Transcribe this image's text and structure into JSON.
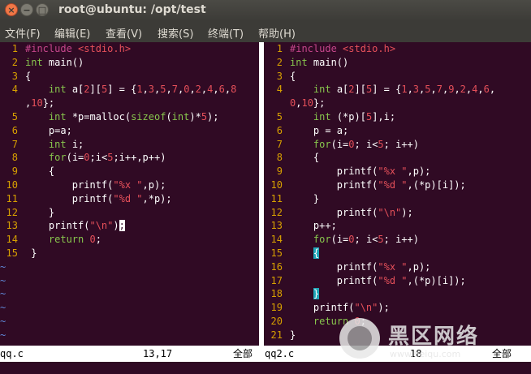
{
  "window": {
    "title": "root@ubuntu: /opt/test",
    "close_glyph": "×",
    "min_glyph": "−",
    "max_glyph": "□"
  },
  "menu": [
    "文件(F)",
    "编辑(E)",
    "查看(V)",
    "搜索(S)",
    "终端(T)",
    "帮助(H)"
  ],
  "colors": {
    "background": "#300a24",
    "line_number": "#d7a000",
    "keyword": "#87c54d",
    "preproc": "#c5468b",
    "string": "#e6505a",
    "tilde": "#5f87d7",
    "match_paren": "#1fa6b7"
  },
  "left_pane": {
    "lines": [
      {
        "n": "1",
        "segs": [
          [
            "p",
            "#include "
          ],
          [
            "s",
            "<stdio.h>"
          ]
        ]
      },
      {
        "n": "2",
        "segs": [
          [
            "k",
            "int"
          ],
          [
            "t",
            " main()"
          ]
        ]
      },
      {
        "n": "3",
        "segs": [
          [
            "t",
            "{"
          ]
        ]
      },
      {
        "n": "4",
        "segs": [
          [
            "t",
            "    "
          ],
          [
            "k",
            "int"
          ],
          [
            "t",
            " a["
          ],
          [
            "n",
            "2"
          ],
          [
            "t",
            "]["
          ],
          [
            "n",
            "5"
          ],
          [
            "t",
            "] = {"
          ],
          [
            "n",
            "1"
          ],
          [
            "t",
            ","
          ],
          [
            "n",
            "3"
          ],
          [
            "t",
            ","
          ],
          [
            "n",
            "5"
          ],
          [
            "t",
            ","
          ],
          [
            "n",
            "7"
          ],
          [
            "t",
            ","
          ],
          [
            "n",
            "0"
          ],
          [
            "t",
            ","
          ],
          [
            "n",
            "2"
          ],
          [
            "t",
            ","
          ],
          [
            "n",
            "4"
          ],
          [
            "t",
            ","
          ],
          [
            "n",
            "6"
          ],
          [
            "t",
            ","
          ],
          [
            "n",
            "8"
          ]
        ]
      },
      {
        "n": "",
        "segs": [
          [
            "t",
            ","
          ],
          [
            "n",
            "10"
          ],
          [
            "t",
            "};"
          ]
        ]
      },
      {
        "n": "5",
        "segs": [
          [
            "t",
            "    "
          ],
          [
            "k",
            "int"
          ],
          [
            "t",
            " *p=malloc("
          ],
          [
            "k",
            "sizeof"
          ],
          [
            "t",
            "("
          ],
          [
            "k",
            "int"
          ],
          [
            "t",
            ")*"
          ],
          [
            "n",
            "5"
          ],
          [
            "t",
            ");"
          ]
        ]
      },
      {
        "n": "6",
        "segs": [
          [
            "t",
            "    p=a;"
          ]
        ]
      },
      {
        "n": "7",
        "segs": [
          [
            "t",
            "    "
          ],
          [
            "k",
            "int"
          ],
          [
            "t",
            " i;"
          ]
        ]
      },
      {
        "n": "8",
        "segs": [
          [
            "t",
            "    "
          ],
          [
            "k",
            "for"
          ],
          [
            "t",
            "(i="
          ],
          [
            "n",
            "0"
          ],
          [
            "t",
            ";i<"
          ],
          [
            "n",
            "5"
          ],
          [
            "t",
            ";i++,p++)"
          ]
        ]
      },
      {
        "n": "9",
        "segs": [
          [
            "t",
            "    {"
          ]
        ]
      },
      {
        "n": "10",
        "segs": [
          [
            "t",
            "        printf("
          ],
          [
            "s",
            "\"%x \""
          ],
          [
            "t",
            ",p);"
          ]
        ]
      },
      {
        "n": "11",
        "segs": [
          [
            "t",
            "        printf("
          ],
          [
            "s",
            "\"%d \""
          ],
          [
            "t",
            ",*p);"
          ]
        ]
      },
      {
        "n": "12",
        "segs": [
          [
            "t",
            "    }"
          ]
        ]
      },
      {
        "n": "13",
        "segs": [
          [
            "t",
            "    printf("
          ],
          [
            "s",
            "\"\\n\""
          ],
          [
            "t",
            ")"
          ],
          [
            "c",
            ";"
          ]
        ]
      },
      {
        "n": "14",
        "segs": [
          [
            "t",
            "    "
          ],
          [
            "k",
            "return"
          ],
          [
            "t",
            " "
          ],
          [
            "n",
            "0"
          ],
          [
            "t",
            ";"
          ]
        ]
      },
      {
        "n": "15",
        "segs": [
          [
            "t",
            " }"
          ]
        ]
      }
    ],
    "tildes": 7,
    "status": {
      "file": "qq.c",
      "pos": "13,17",
      "scroll": "全部"
    }
  },
  "right_pane": {
    "lines": [
      {
        "n": "1",
        "segs": [
          [
            "p",
            "#include "
          ],
          [
            "s",
            "<stdio.h>"
          ]
        ]
      },
      {
        "n": "2",
        "segs": [
          [
            "k",
            "int"
          ],
          [
            "t",
            " main()"
          ]
        ]
      },
      {
        "n": "3",
        "segs": [
          [
            "t",
            "{"
          ]
        ]
      },
      {
        "n": "4",
        "segs": [
          [
            "t",
            "    "
          ],
          [
            "k",
            "int"
          ],
          [
            "t",
            " a["
          ],
          [
            "n",
            "2"
          ],
          [
            "t",
            "]["
          ],
          [
            "n",
            "5"
          ],
          [
            "t",
            "] = {"
          ],
          [
            "n",
            "1"
          ],
          [
            "t",
            ","
          ],
          [
            "n",
            "3"
          ],
          [
            "t",
            ","
          ],
          [
            "n",
            "5"
          ],
          [
            "t",
            ","
          ],
          [
            "n",
            "7"
          ],
          [
            "t",
            ","
          ],
          [
            "n",
            "9"
          ],
          [
            "t",
            ","
          ],
          [
            "n",
            "2"
          ],
          [
            "t",
            ","
          ],
          [
            "n",
            "4"
          ],
          [
            "t",
            ","
          ],
          [
            "n",
            "6"
          ],
          [
            "t",
            ","
          ]
        ]
      },
      {
        "n": "",
        "segs": [
          [
            "n",
            "0"
          ],
          [
            "t",
            ","
          ],
          [
            "n",
            "10"
          ],
          [
            "t",
            "};"
          ]
        ]
      },
      {
        "n": "5",
        "segs": [
          [
            "t",
            "    "
          ],
          [
            "k",
            "int"
          ],
          [
            "t",
            " (*p)["
          ],
          [
            "n",
            "5"
          ],
          [
            "t",
            "],i;"
          ]
        ]
      },
      {
        "n": "6",
        "segs": [
          [
            "t",
            "    p = a;"
          ]
        ]
      },
      {
        "n": "7",
        "segs": [
          [
            "t",
            "    "
          ],
          [
            "k",
            "for"
          ],
          [
            "t",
            "(i="
          ],
          [
            "n",
            "0"
          ],
          [
            "t",
            "; i<"
          ],
          [
            "n",
            "5"
          ],
          [
            "t",
            "; i++)"
          ]
        ]
      },
      {
        "n": "8",
        "segs": [
          [
            "t",
            "    {"
          ]
        ]
      },
      {
        "n": "9",
        "segs": [
          [
            "t",
            "        printf("
          ],
          [
            "s",
            "\"%x \""
          ],
          [
            "t",
            ",p);"
          ]
        ]
      },
      {
        "n": "10",
        "segs": [
          [
            "t",
            "        printf("
          ],
          [
            "s",
            "\"%d \""
          ],
          [
            "t",
            ",(*p)[i]);"
          ]
        ]
      },
      {
        "n": "11",
        "segs": [
          [
            "t",
            "    }"
          ]
        ]
      },
      {
        "n": "12",
        "segs": [
          [
            "t",
            "        printf("
          ],
          [
            "s",
            "\"\\n\""
          ],
          [
            "t",
            ");"
          ]
        ]
      },
      {
        "n": "13",
        "segs": [
          [
            "t",
            "    p++;"
          ]
        ]
      },
      {
        "n": "14",
        "segs": [
          [
            "t",
            "    "
          ],
          [
            "k",
            "for"
          ],
          [
            "t",
            "(i="
          ],
          [
            "n",
            "0"
          ],
          [
            "t",
            "; i<"
          ],
          [
            "n",
            "5"
          ],
          [
            "t",
            "; i++)"
          ]
        ]
      },
      {
        "n": "15",
        "segs": [
          [
            "t",
            "    "
          ],
          [
            "h",
            "{"
          ]
        ]
      },
      {
        "n": "16",
        "segs": [
          [
            "t",
            "        printf("
          ],
          [
            "s",
            "\"%x \""
          ],
          [
            "t",
            ",p);"
          ]
        ]
      },
      {
        "n": "17",
        "segs": [
          [
            "t",
            "        printf("
          ],
          [
            "s",
            "\"%d \""
          ],
          [
            "t",
            ",(*p)[i]);"
          ]
        ]
      },
      {
        "n": "18",
        "segs": [
          [
            "t",
            "    "
          ],
          [
            "h",
            "}"
          ]
        ]
      },
      {
        "n": "19",
        "segs": [
          [
            "t",
            "    printf("
          ],
          [
            "s",
            "\"\\n\""
          ],
          [
            "t",
            ");"
          ]
        ]
      },
      {
        "n": "20",
        "segs": [
          [
            "t",
            "    "
          ],
          [
            "k",
            "return"
          ],
          [
            "t",
            " "
          ],
          [
            "n",
            "0"
          ],
          [
            "t",
            ";"
          ]
        ]
      },
      {
        "n": "21",
        "segs": [
          [
            "t",
            "}"
          ]
        ]
      }
    ],
    "status": {
      "file": "qq2.c",
      "pos": "18",
      "scroll": "全部"
    }
  },
  "watermark": {
    "brand": "黑区网络",
    "url": "www.heiqu.com"
  }
}
